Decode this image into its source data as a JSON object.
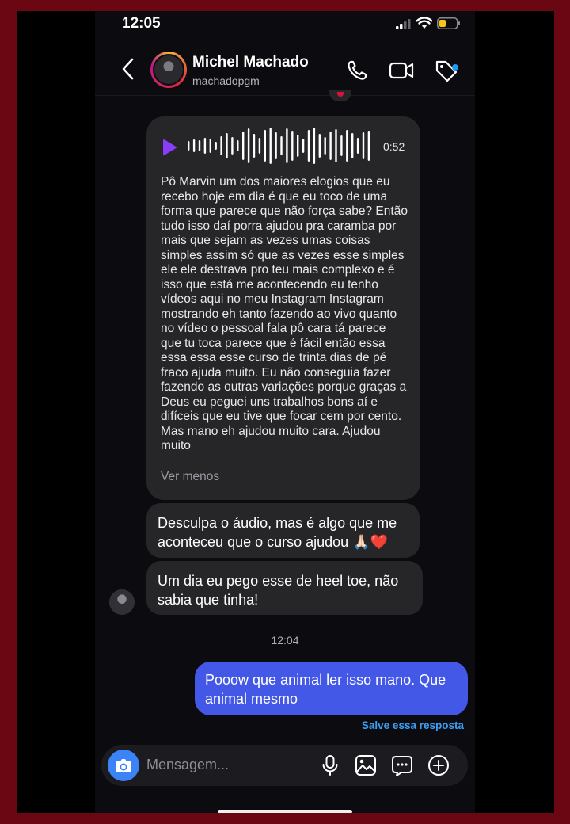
{
  "status_bar": {
    "time": "12:05"
  },
  "header": {
    "name": "Michel Machado",
    "handle": "machadopgm"
  },
  "audio_message": {
    "duration": "0:52",
    "transcript": "Pô Marvin um dos maiores elogios que eu recebo hoje em dia é que eu toco de uma forma que parece que não força sabe? Então tudo isso daí porra ajudou pra caramba por mais que sejam as vezes umas coisas simples assim só que as vezes esse simples ele ele destrava pro teu mais complexo e é isso que está me acontecendo eu tenho vídeos aqui no meu Instagram Instagram mostrando eh tanto fazendo ao vivo quanto no vídeo o pessoal fala pô cara tá parece que tu toca parece que é fácil então essa essa essa esse curso de trinta dias de pé fraco ajuda muito. Eu não conseguia fazer fazendo as outras variações porque graças a Deus eu peguei uns trabalhos bons aí e difíceis que eu tive que focar cem por cento. Mas mano eh ajudou muito cara. Ajudou muito",
    "toggle_label": "Ver menos"
  },
  "messages": [
    {
      "text": "Desculpa o áudio, mas é algo que me aconteceu que o curso ajudou 🙏🏻❤️"
    },
    {
      "text": "Um dia eu pego esse de heel toe, não sabia que tinha!"
    }
  ],
  "timestamp": "12:04",
  "sent_message": {
    "text": "Pooow que animal ler isso mano. Que animal mesmo"
  },
  "save_reply_label": "Salve essa resposta",
  "composer": {
    "placeholder": "Mensagem..."
  },
  "colors": {
    "frame": "#6b0713",
    "background": "#0c0c10",
    "received_bubble": "#262629",
    "sent_bubble": "#4458e8",
    "link": "#3aa0f7",
    "play_icon": "#8b3cf7",
    "camera_button": "#3b83f6"
  },
  "icons": [
    "back-chevron-icon",
    "phone-icon",
    "video-camera-icon",
    "tag-icon",
    "play-icon",
    "camera-icon",
    "microphone-icon",
    "image-icon",
    "sticker-icon",
    "plus-icon"
  ]
}
